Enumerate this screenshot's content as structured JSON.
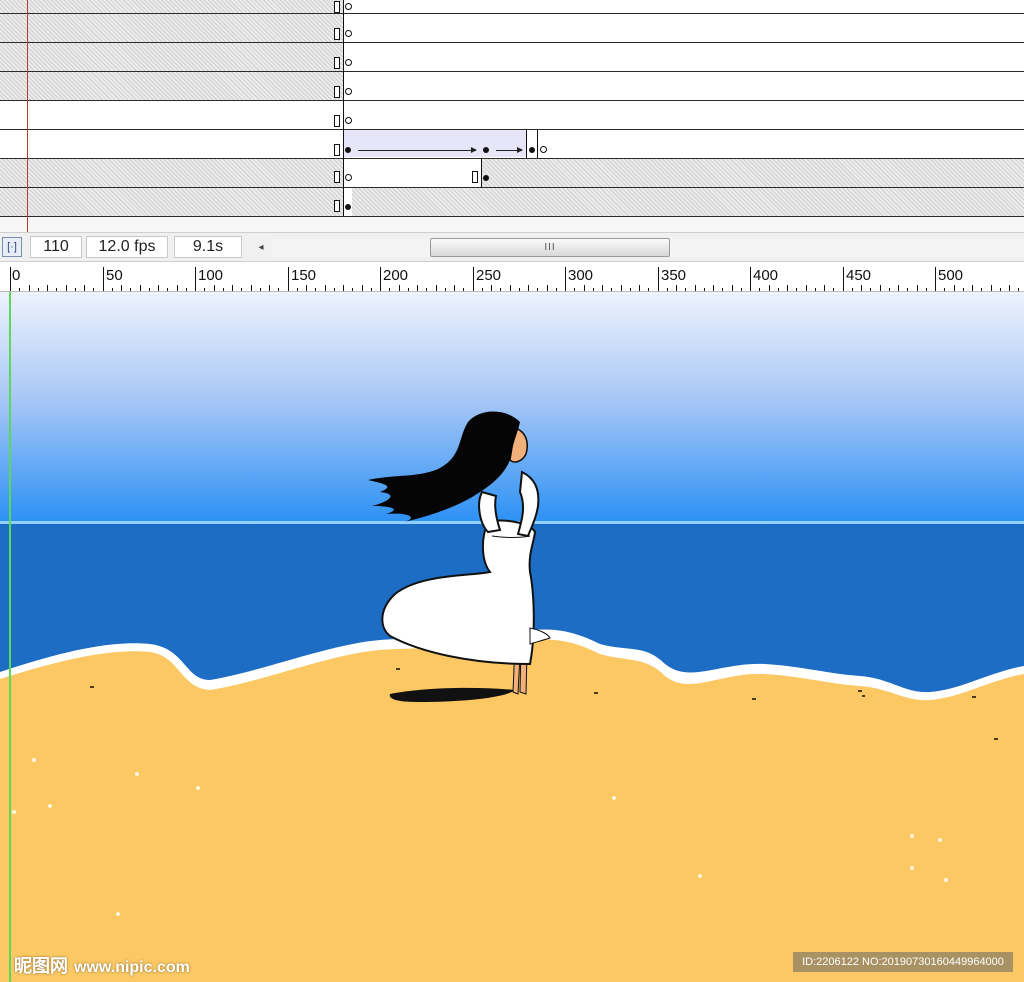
{
  "status_bar": {
    "current_frame": "110",
    "frame_rate": "12.0 fps",
    "elapsed_time": "9.1s",
    "scroll_thumb_grip": "III",
    "center_frame_icon": "center-frame-icon",
    "scroll_left_icon": "◂"
  },
  "ruler": {
    "labels": [
      "0",
      "50",
      "100",
      "150",
      "200",
      "250",
      "300",
      "350",
      "400",
      "450",
      "500"
    ]
  },
  "timeline": {
    "layer_count": 8
  },
  "colors": {
    "sky_top": "#eef3fc",
    "sky_bottom": "#2b90f5",
    "sea": "#1e6dc4",
    "sand": "#fbc863",
    "foam": "#ffffff",
    "hair": "#050505",
    "dress": "#ffffff",
    "playhead": "#c0392b",
    "guide": "#5ad85a"
  },
  "watermark": {
    "site_name": "昵图网",
    "site_url": "www.nipic.com",
    "image_id": "ID:2206122 NO:20190730160449964000"
  }
}
